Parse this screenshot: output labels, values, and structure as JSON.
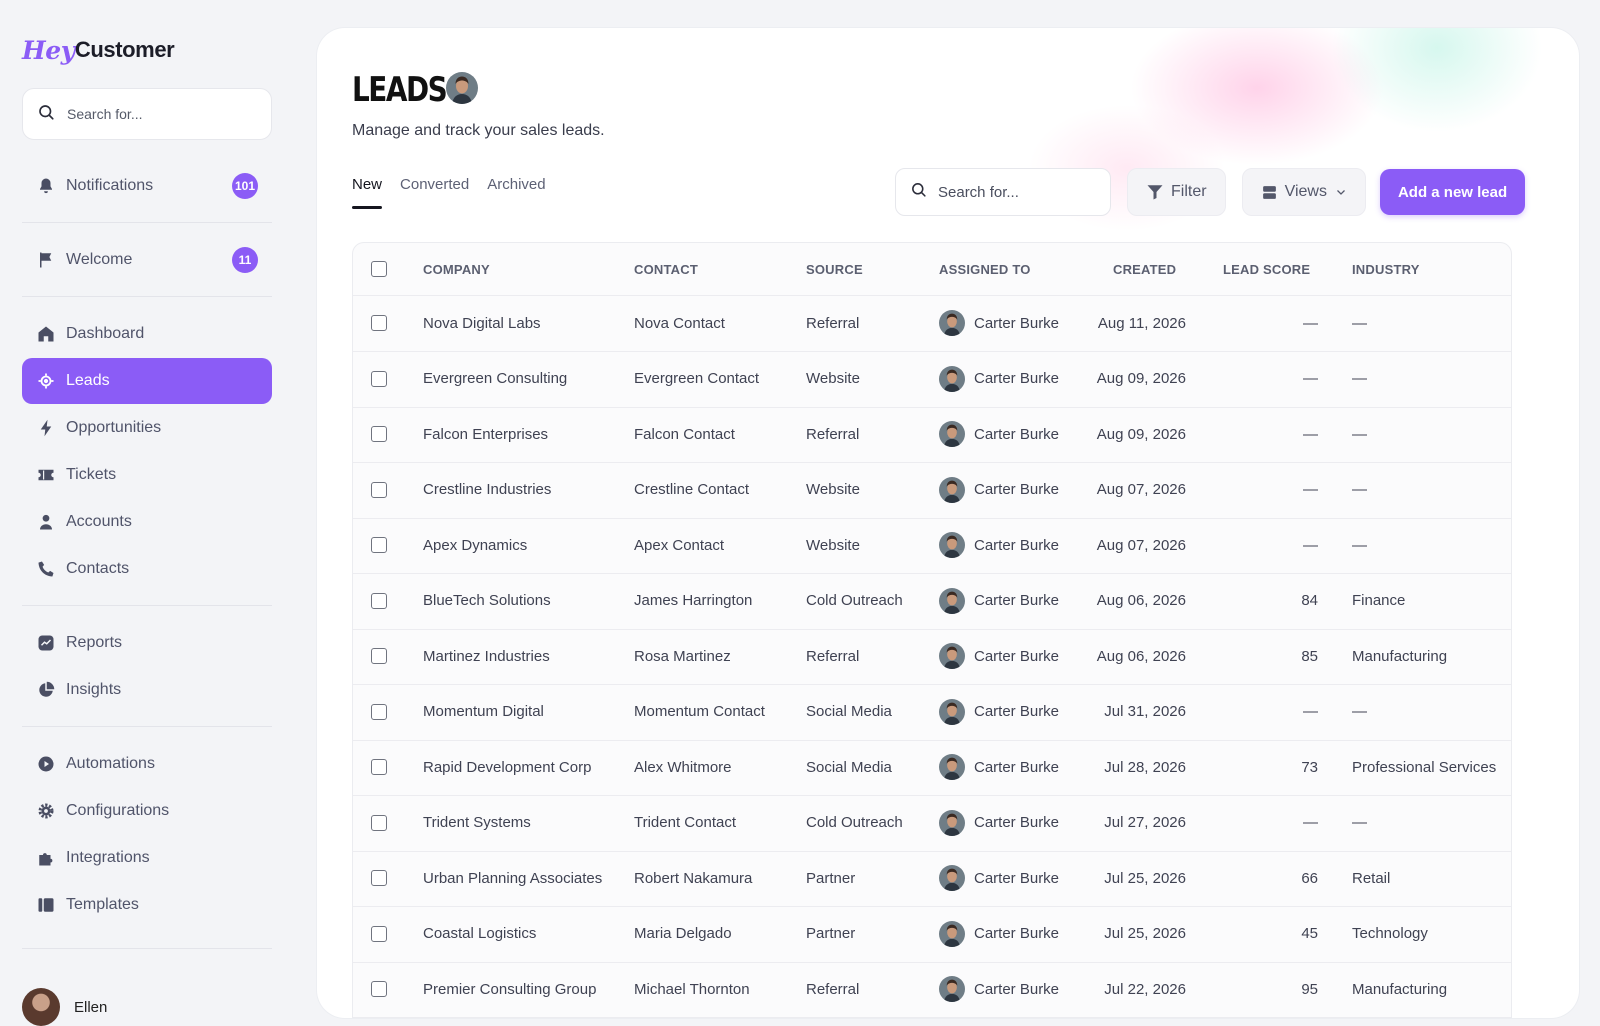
{
  "app": {
    "logo_hey": "Hey",
    "logo_customer": "Customer"
  },
  "sidebar": {
    "search_placeholder": "Search for...",
    "items": [
      {
        "label": "Notifications",
        "icon": "bell-icon",
        "badge": "101"
      },
      {
        "label": "Welcome",
        "icon": "flag-icon",
        "badge": "11"
      },
      {
        "label": "Dashboard",
        "icon": "home-icon"
      },
      {
        "label": "Leads",
        "icon": "target-icon",
        "active": true
      },
      {
        "label": "Opportunities",
        "icon": "bolt-icon"
      },
      {
        "label": "Tickets",
        "icon": "ticket-icon"
      },
      {
        "label": "Accounts",
        "icon": "user-icon"
      },
      {
        "label": "Contacts",
        "icon": "phone-icon"
      },
      {
        "label": "Reports",
        "icon": "chart-icon"
      },
      {
        "label": "Insights",
        "icon": "pie-icon"
      },
      {
        "label": "Automations",
        "icon": "play-icon"
      },
      {
        "label": "Configurations",
        "icon": "gear-icon"
      },
      {
        "label": "Integrations",
        "icon": "puzzle-icon"
      },
      {
        "label": "Templates",
        "icon": "template-icon"
      }
    ],
    "user_name": "Ellen"
  },
  "main": {
    "title": "LEADS",
    "subtitle": "Manage and track your sales leads.",
    "tabs": [
      "New",
      "Converted",
      "Archived"
    ],
    "active_tab": "New",
    "search_placeholder": "Search for...",
    "filter_label": "Filter",
    "views_label": "Views",
    "add_label": "Add a new lead"
  },
  "colors": {
    "accent": "#8b5cf6"
  },
  "table": {
    "columns": [
      "Company",
      "Contact",
      "Source",
      "Assigned To",
      "Created",
      "Lead Score",
      "Industry"
    ],
    "rows": [
      {
        "company": "Nova Digital Labs",
        "contact": "Nova Contact",
        "source": "Referral",
        "assigned": "Carter Burke",
        "created": "Aug 11, 2026",
        "score": "—",
        "industry": "—"
      },
      {
        "company": "Evergreen Consulting",
        "contact": "Evergreen Contact",
        "source": "Website",
        "assigned": "Carter Burke",
        "created": "Aug 09, 2026",
        "score": "—",
        "industry": "—"
      },
      {
        "company": "Falcon Enterprises",
        "contact": "Falcon Contact",
        "source": "Referral",
        "assigned": "Carter Burke",
        "created": "Aug 09, 2026",
        "score": "—",
        "industry": "—"
      },
      {
        "company": "Crestline Industries",
        "contact": "Crestline Contact",
        "source": "Website",
        "assigned": "Carter Burke",
        "created": "Aug 07, 2026",
        "score": "—",
        "industry": "—"
      },
      {
        "company": "Apex Dynamics",
        "contact": "Apex Contact",
        "source": "Website",
        "assigned": "Carter Burke",
        "created": "Aug 07, 2026",
        "score": "—",
        "industry": "—"
      },
      {
        "company": "BlueTech Solutions",
        "contact": "James Harrington",
        "source": "Cold Outreach",
        "assigned": "Carter Burke",
        "created": "Aug 06, 2026",
        "score": "84",
        "industry": "Finance"
      },
      {
        "company": "Martinez Industries",
        "contact": "Rosa Martinez",
        "source": "Referral",
        "assigned": "Carter Burke",
        "created": "Aug 06, 2026",
        "score": "85",
        "industry": "Manufacturing"
      },
      {
        "company": "Momentum Digital",
        "contact": "Momentum Contact",
        "source": "Social Media",
        "assigned": "Carter Burke",
        "created": "Jul 31, 2026",
        "score": "—",
        "industry": "—"
      },
      {
        "company": "Rapid Development Corp",
        "contact": "Alex Whitmore",
        "source": "Social Media",
        "assigned": "Carter Burke",
        "created": "Jul 28, 2026",
        "score": "73",
        "industry": "Professional Services"
      },
      {
        "company": "Trident Systems",
        "contact": "Trident Contact",
        "source": "Cold Outreach",
        "assigned": "Carter Burke",
        "created": "Jul 27, 2026",
        "score": "—",
        "industry": "—"
      },
      {
        "company": "Urban Planning Associates",
        "contact": "Robert Nakamura",
        "source": "Partner",
        "assigned": "Carter Burke",
        "created": "Jul 25, 2026",
        "score": "66",
        "industry": "Retail"
      },
      {
        "company": "Coastal Logistics",
        "contact": "Maria Delgado",
        "source": "Partner",
        "assigned": "Carter Burke",
        "created": "Jul 25, 2026",
        "score": "45",
        "industry": "Technology"
      },
      {
        "company": "Premier Consulting Group",
        "contact": "Michael Thornton",
        "source": "Referral",
        "assigned": "Carter Burke",
        "created": "Jul 22, 2026",
        "score": "95",
        "industry": "Manufacturing"
      }
    ]
  }
}
